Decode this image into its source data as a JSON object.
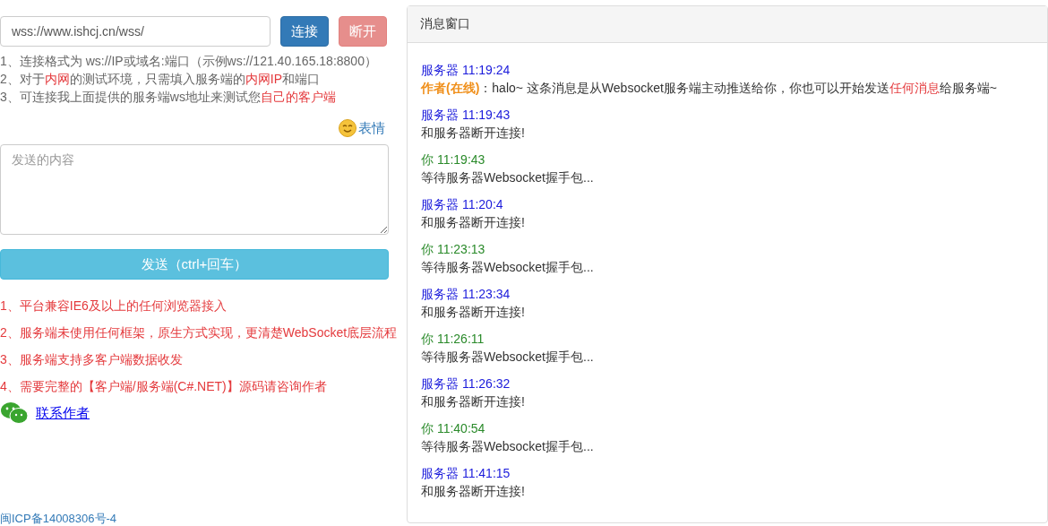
{
  "connection": {
    "url": "wss://www.ishcj.cn/wss/",
    "buttons": [
      {
        "label": "连接",
        "kind": "primary",
        "disabled": false
      },
      {
        "label": "断开",
        "kind": "danger",
        "disabled": true
      }
    ]
  },
  "hints": [
    [
      {
        "text": "1、连接格式为 ws://IP或域名:端口（示例ws://121.40.165.18:8800）",
        "highlight": false
      }
    ],
    [
      {
        "text": "2、对于",
        "highlight": false
      },
      {
        "text": "内网",
        "highlight": true
      },
      {
        "text": "的测试环境，只需填入服务端的",
        "highlight": false
      },
      {
        "text": "内网IP",
        "highlight": true
      },
      {
        "text": "和端口",
        "highlight": false
      }
    ],
    [
      {
        "text": "3、可连接我上面提供的服务端ws地址来测试您",
        "highlight": false
      },
      {
        "text": "自己的客户端",
        "highlight": true
      }
    ]
  ],
  "emoji_button": "表情",
  "message_input": {
    "placeholder": "发送的内容"
  },
  "send_button": "发送（ctrl+回车）",
  "features": [
    "1、平台兼容IE6及以上的任何浏览器接入",
    "2、服务端未使用任何框架，原生方式实现，更清楚WebSocket底层流程",
    "3、服务端支持多客户端数据收发",
    "4、需要完整的【客户端/服务端(C#.NET)】源码请咨询作者"
  ],
  "contact_link": "联系作者",
  "footer": "闽ICP备14008306号-4",
  "message_panel": {
    "title": "消息窗口",
    "messages": [
      {
        "kind": "server",
        "sender": "服务器",
        "time": "11:19:24",
        "body": [
          {
            "kind": "author",
            "text": "作者(在线)"
          },
          {
            "kind": "plain",
            "text": "：halo~ 这条消息是从Websocket服务端主动推送给你，你也可以开始发送"
          },
          {
            "kind": "highlight",
            "text": "任何消息"
          },
          {
            "kind": "plain",
            "text": "给服务端~"
          }
        ]
      },
      {
        "kind": "server",
        "sender": "服务器",
        "time": "11:19:43",
        "body": [
          {
            "kind": "plain",
            "text": "和服务器断开连接!"
          }
        ]
      },
      {
        "kind": "you",
        "sender": "你",
        "time": "11:19:43",
        "body": [
          {
            "kind": "plain",
            "text": "等待服务器Websocket握手包..."
          }
        ]
      },
      {
        "kind": "server",
        "sender": "服务器",
        "time": "11:20:4",
        "body": [
          {
            "kind": "plain",
            "text": "和服务器断开连接!"
          }
        ]
      },
      {
        "kind": "you",
        "sender": "你",
        "time": "11:23:13",
        "body": [
          {
            "kind": "plain",
            "text": "等待服务器Websocket握手包..."
          }
        ]
      },
      {
        "kind": "server",
        "sender": "服务器",
        "time": "11:23:34",
        "body": [
          {
            "kind": "plain",
            "text": "和服务器断开连接!"
          }
        ]
      },
      {
        "kind": "you",
        "sender": "你",
        "time": "11:26:11",
        "body": [
          {
            "kind": "plain",
            "text": "等待服务器Websocket握手包..."
          }
        ]
      },
      {
        "kind": "server",
        "sender": "服务器",
        "time": "11:26:32",
        "body": [
          {
            "kind": "plain",
            "text": "和服务器断开连接!"
          }
        ]
      },
      {
        "kind": "you",
        "sender": "你",
        "time": "11:40:54",
        "body": [
          {
            "kind": "plain",
            "text": "等待服务器Websocket握手包..."
          }
        ]
      },
      {
        "kind": "server",
        "sender": "服务器",
        "time": "11:41:15",
        "body": [
          {
            "kind": "plain",
            "text": "和服务器断开连接!"
          }
        ]
      }
    ]
  }
}
